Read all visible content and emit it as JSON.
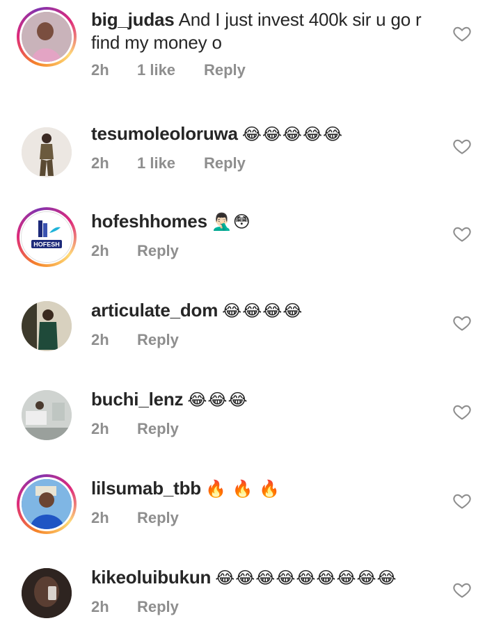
{
  "comments": [
    {
      "username": "big_judas",
      "text": "And I just invest 400k sir u go r find my money o",
      "time": "2h",
      "likes": "1 like",
      "reply": "Reply"
    },
    {
      "username": "tesumoleoloruwa",
      "text": "😂😂😂😂😂",
      "time": "2h",
      "likes": "1 like",
      "reply": "Reply"
    },
    {
      "username": "hofeshhomes",
      "text": "🤦🏻‍♂️😳",
      "time": "2h",
      "reply": "Reply",
      "avatar_text": "HOFESH"
    },
    {
      "username": "articulate_dom",
      "text": "😂😂😂😂",
      "time": "2h",
      "reply": "Reply"
    },
    {
      "username": "buchi_lenz",
      "text": "😂😂😂",
      "time": "2h",
      "reply": "Reply"
    },
    {
      "username": "lilsumab_tbb",
      "text": "🔥 🔥 🔥",
      "time": "2h",
      "reply": "Reply"
    },
    {
      "username": "kikeoluibukun",
      "text": "😂😂😂😂😂😂😂😂😂",
      "time": "2h",
      "reply": "Reply"
    }
  ],
  "icons": {
    "like": "heart-outline-icon"
  },
  "colors": {
    "text": "#262626",
    "meta": "#8e8e8e",
    "story_ring": "#dd2a7b"
  }
}
